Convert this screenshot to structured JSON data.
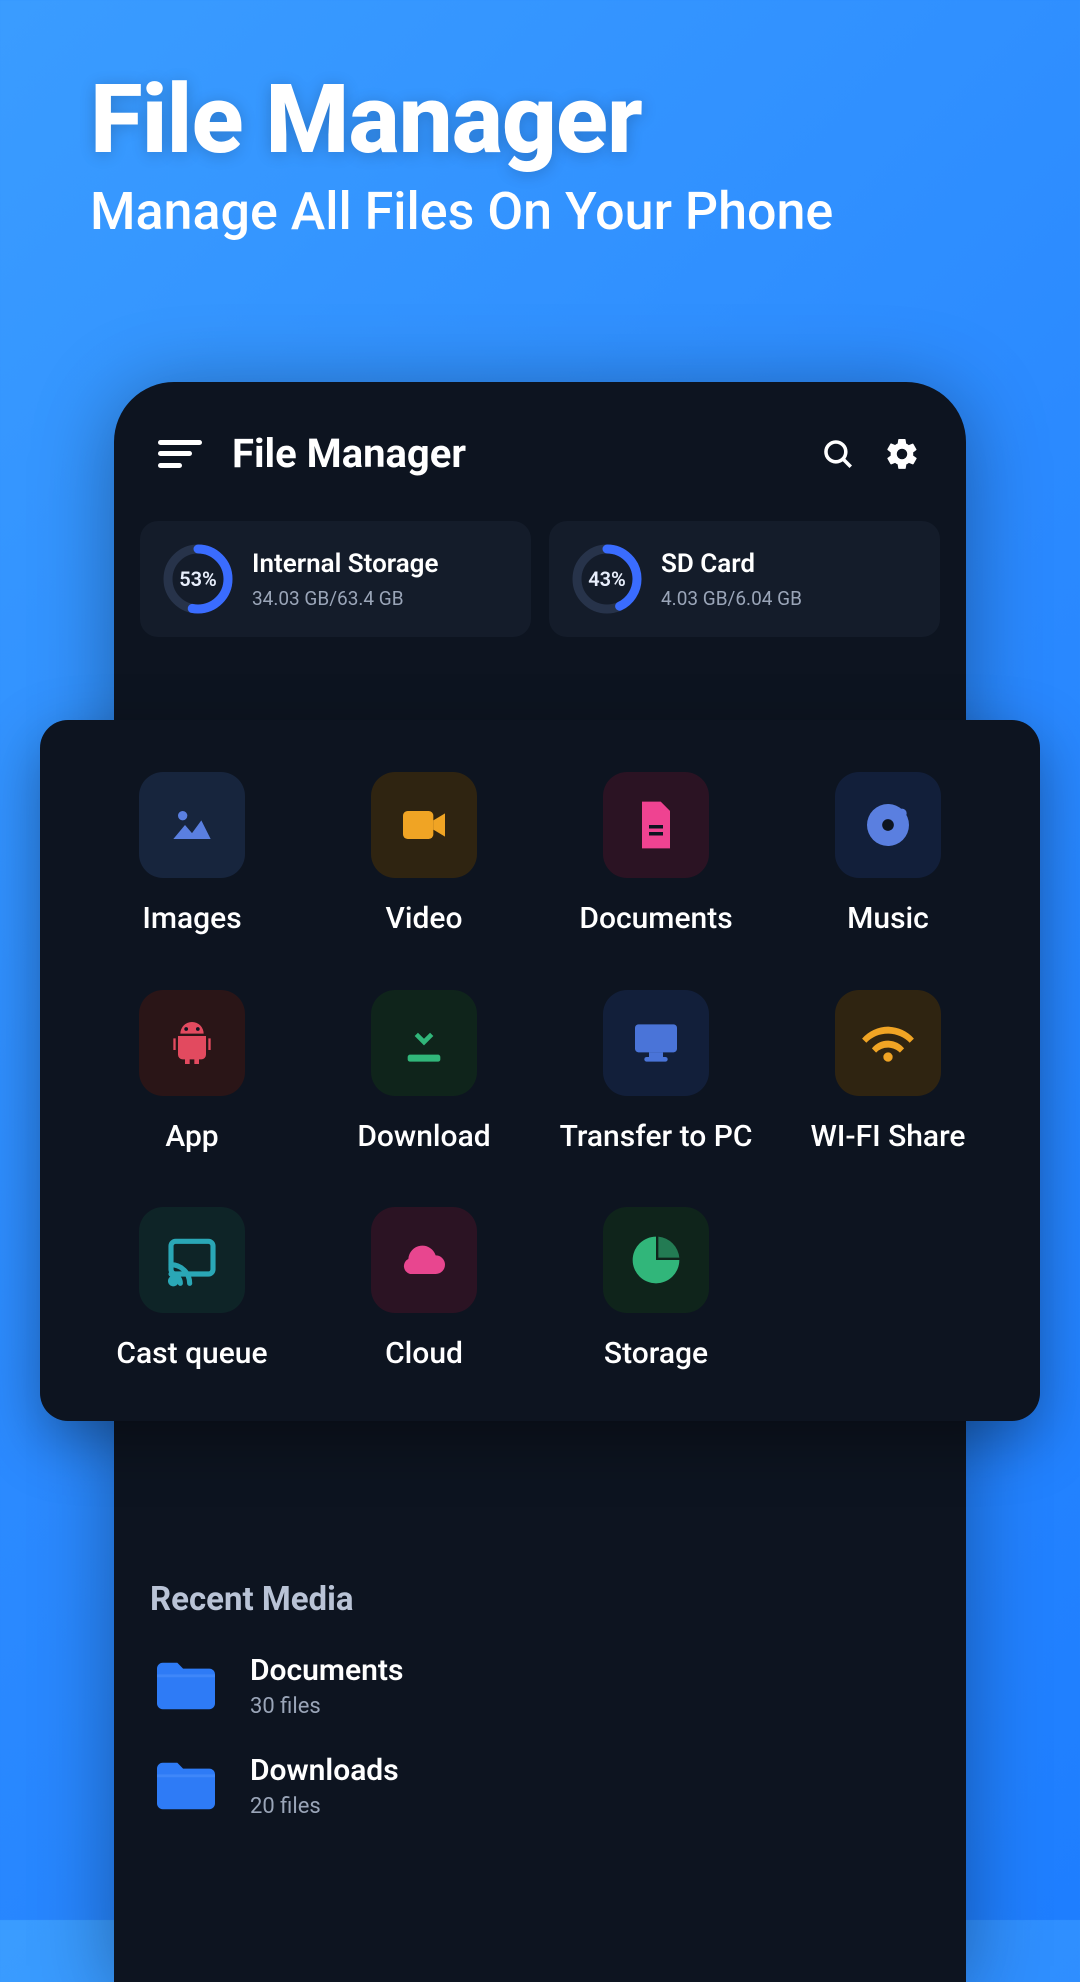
{
  "hero": {
    "title": "File Manager",
    "subtitle": "Manage All Files On Your Phone"
  },
  "app": {
    "title": "File Manager"
  },
  "storage": [
    {
      "name": "Internal Storage",
      "sub": "34.03 GB/63.4 GB",
      "percent_label": "53%",
      "percent": 53
    },
    {
      "name": "SD Card",
      "sub": "4.03 GB/6.04 GB",
      "percent_label": "43%",
      "percent": 43
    }
  ],
  "tiles": [
    {
      "label": "Images",
      "icon": "image",
      "bg": "#17253d",
      "fg": "#5a7fe0"
    },
    {
      "label": "Video",
      "icon": "video",
      "bg": "#2f2411",
      "fg": "#f0a424"
    },
    {
      "label": "Documents",
      "icon": "document",
      "bg": "#2b1323",
      "fg": "#ef4391"
    },
    {
      "label": "Music",
      "icon": "music",
      "bg": "#121f3a",
      "fg": "#5a7fe0"
    },
    {
      "label": "App",
      "icon": "android",
      "bg": "#2a1517",
      "fg": "#e24a5f"
    },
    {
      "label": "Download",
      "icon": "download",
      "bg": "#0f241b",
      "fg": "#31b67a"
    },
    {
      "label": "Transfer to PC",
      "icon": "pc",
      "bg": "#121f3a",
      "fg": "#4a74d8"
    },
    {
      "label": "WI-FI Share",
      "icon": "wifi",
      "bg": "#2f2411",
      "fg": "#f0a424"
    },
    {
      "label": "Cast queue",
      "icon": "cast",
      "bg": "#0e2427",
      "fg": "#2aa7b6"
    },
    {
      "label": "Cloud",
      "icon": "cloud",
      "bg": "#2b1323",
      "fg": "#e8468f"
    },
    {
      "label": "Storage",
      "icon": "storage",
      "bg": "#0f241b",
      "fg": "#31b67a"
    }
  ],
  "recent": {
    "title": "Recent Media",
    "items": [
      {
        "name": "Documents",
        "count": "30 files"
      },
      {
        "name": "Downloads",
        "count": "20 files"
      }
    ]
  },
  "colors": {
    "accent": "#3a6cff",
    "track": "#27334a"
  }
}
